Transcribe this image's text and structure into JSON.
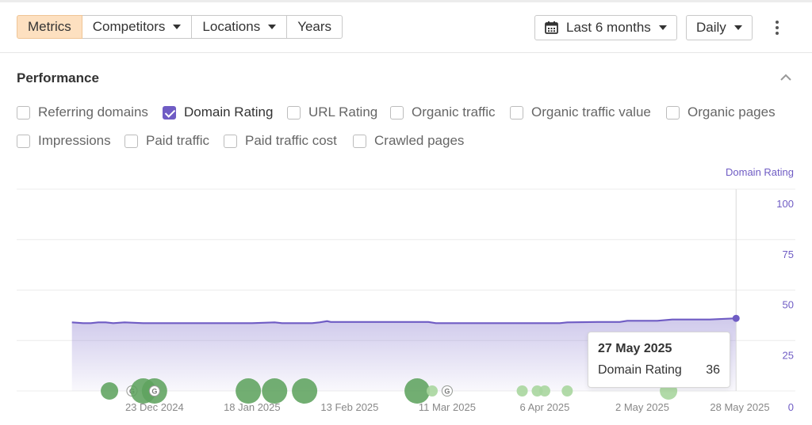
{
  "toolbar": {
    "tabs": [
      {
        "label": "Metrics",
        "active": true,
        "dropdown": false
      },
      {
        "label": "Competitors",
        "active": false,
        "dropdown": true
      },
      {
        "label": "Locations",
        "active": false,
        "dropdown": true
      },
      {
        "label": "Years",
        "active": false,
        "dropdown": false
      }
    ],
    "date_range": {
      "label": "Last 6 months",
      "icon": "calendar-icon"
    },
    "granularity": {
      "label": "Daily"
    },
    "more_icon": "kebab-menu-icon"
  },
  "section": {
    "title": "Performance",
    "collapse_icon": "chevron-up-icon"
  },
  "metrics": [
    {
      "label": "Referring domains",
      "checked": false
    },
    {
      "label": "Domain Rating",
      "checked": true
    },
    {
      "label": "URL Rating",
      "checked": false
    },
    {
      "label": "Organic traffic",
      "checked": false
    },
    {
      "label": "Organic traffic value",
      "checked": false
    },
    {
      "label": "Organic pages",
      "checked": false
    },
    {
      "label": "Impressions",
      "checked": false
    },
    {
      "label": "Paid traffic",
      "checked": false
    },
    {
      "label": "Paid traffic cost",
      "checked": false
    },
    {
      "label": "Crawled pages",
      "checked": false
    }
  ],
  "colors": {
    "accent": "#6f5cc4",
    "active_tab_bg": "#fde0c0",
    "event_dark": "#5ea35e",
    "event_light": "#a9d69f"
  },
  "chart_data": {
    "type": "area",
    "series": [
      {
        "name": "Domain Rating",
        "x": [
          "2024-12-01",
          "2024-12-04",
          "2024-12-06",
          "2024-12-08",
          "2024-12-10",
          "2024-12-12",
          "2024-12-15",
          "2024-12-20",
          "2024-12-25",
          "2025-01-01",
          "2025-01-10",
          "2025-01-18",
          "2025-01-24",
          "2025-01-26",
          "2025-01-28",
          "2025-02-03",
          "2025-02-05",
          "2025-02-07",
          "2025-02-08",
          "2025-02-10",
          "2025-02-20",
          "2025-03-01",
          "2025-03-06",
          "2025-03-08",
          "2025-03-20",
          "2025-04-01",
          "2025-04-10",
          "2025-04-12",
          "2025-04-20",
          "2025-04-26",
          "2025-04-28",
          "2025-05-06",
          "2025-05-10",
          "2025-05-12",
          "2025-05-20",
          "2025-05-27"
        ],
        "values": [
          34,
          33.6,
          33.6,
          34,
          34,
          33.6,
          34,
          33.6,
          33.6,
          33.6,
          33.6,
          33.6,
          34,
          33.6,
          33.6,
          33.6,
          34,
          34.6,
          34.2,
          34.2,
          34.2,
          34.2,
          34.2,
          33.6,
          33.6,
          33.6,
          33.6,
          34,
          34.2,
          34.2,
          34.8,
          34.8,
          35.4,
          35.4,
          35.4,
          36
        ]
      }
    ],
    "ylabel": "Domain Rating",
    "ylim": [
      0,
      100
    ],
    "yticks": [
      0,
      25,
      50,
      75,
      100
    ],
    "xlim": [
      "2024-11-30",
      "2025-05-28"
    ],
    "xticks": [
      {
        "date": "2024-12-23",
        "label": "23 Dec 2024"
      },
      {
        "date": "2025-01-18",
        "label": "18 Jan 2025"
      },
      {
        "date": "2025-02-13",
        "label": "13 Feb 2025"
      },
      {
        "date": "2025-03-11",
        "label": "11 Mar 2025"
      },
      {
        "date": "2025-04-06",
        "label": "6 Apr 2025"
      },
      {
        "date": "2025-05-02",
        "label": "2 May 2025"
      },
      {
        "date": "2025-05-28",
        "label": "28 May 2025"
      }
    ],
    "events": [
      {
        "date": "2024-12-11",
        "size": "medium",
        "shade": "dark",
        "google": false
      },
      {
        "date": "2024-12-17",
        "size": "small",
        "shade": "light",
        "google": true
      },
      {
        "date": "2024-12-20",
        "size": "large",
        "shade": "dark",
        "google": false
      },
      {
        "date": "2024-12-23",
        "size": "large",
        "shade": "dark",
        "google": true
      },
      {
        "date": "2025-01-17",
        "size": "large",
        "shade": "dark",
        "google": false
      },
      {
        "date": "2025-01-24",
        "size": "large",
        "shade": "dark",
        "google": false
      },
      {
        "date": "2025-02-01",
        "size": "large",
        "shade": "dark",
        "google": false
      },
      {
        "date": "2025-03-03",
        "size": "large",
        "shade": "dark",
        "google": false
      },
      {
        "date": "2025-03-07",
        "size": "small",
        "shade": "light",
        "google": false
      },
      {
        "date": "2025-03-11",
        "size": "small",
        "shade": "light",
        "google": true
      },
      {
        "date": "2025-03-31",
        "size": "small",
        "shade": "light",
        "google": false
      },
      {
        "date": "2025-04-04",
        "size": "small",
        "shade": "light",
        "google": false
      },
      {
        "date": "2025-04-06",
        "size": "small",
        "shade": "light",
        "google": false
      },
      {
        "date": "2025-04-12",
        "size": "small",
        "shade": "light",
        "google": false
      },
      {
        "date": "2025-05-09",
        "size": "medium",
        "shade": "light",
        "google": false
      }
    ],
    "tooltip": {
      "date": "27 May 2025",
      "series": "Domain Rating",
      "value": "36"
    },
    "grid": true,
    "legend": "top-right"
  }
}
